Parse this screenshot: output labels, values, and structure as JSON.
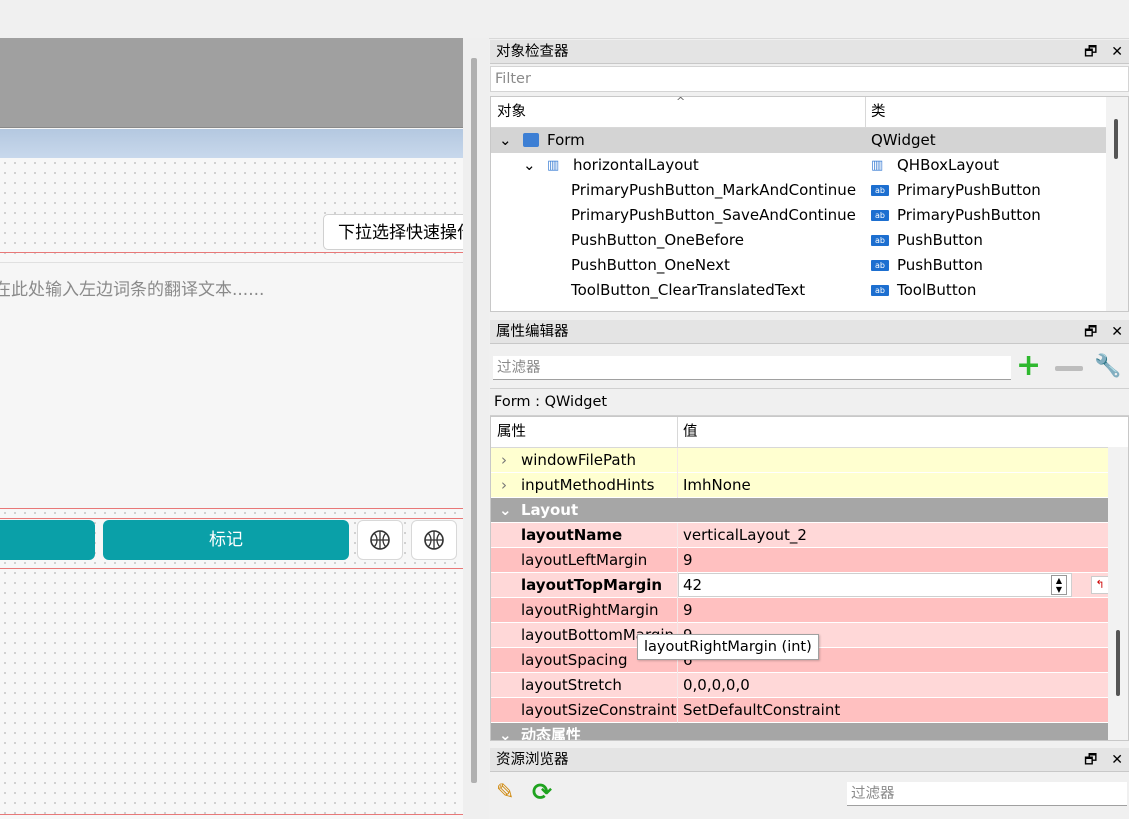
{
  "designer": {
    "dropdown_text": "下拉选择快速操作",
    "translation_placeholder": "在此处输入左边词条的翻译文本......",
    "mark_button": "标记"
  },
  "object_inspector": {
    "title": "对象检查器",
    "filter_placeholder": "Filter",
    "col_object": "对象",
    "col_class": "类",
    "rows": [
      {
        "name": "Form",
        "cls": "QWidget"
      },
      {
        "name": "horizontalLayout",
        "cls": "QHBoxLayout"
      },
      {
        "name": "PrimaryPushButton_MarkAndContinue",
        "cls": "PrimaryPushButton"
      },
      {
        "name": "PrimaryPushButton_SaveAndContinue",
        "cls": "PrimaryPushButton"
      },
      {
        "name": "PushButton_OneBefore",
        "cls": "PushButton"
      },
      {
        "name": "PushButton_OneNext",
        "cls": "PushButton"
      },
      {
        "name": "ToolButton_ClearTranslatedText",
        "cls": "ToolButton"
      }
    ]
  },
  "property_editor": {
    "title": "属性编辑器",
    "filter_placeholder": "过滤器",
    "context": "Form : QWidget",
    "col_prop": "属性",
    "col_value": "值",
    "rows": [
      {
        "name": "windowFilePath",
        "value": ""
      },
      {
        "name": "inputMethodHints",
        "value": "ImhNone"
      },
      {
        "name": "Layout",
        "value": ""
      },
      {
        "name": "layoutName",
        "value": "verticalLayout_2"
      },
      {
        "name": "layoutLeftMargin",
        "value": "9"
      },
      {
        "name": "layoutTopMargin",
        "value": "42"
      },
      {
        "name": "layoutRightMargin",
        "value": "9"
      },
      {
        "name": "layoutBottomMargin",
        "value": "9"
      },
      {
        "name": "layoutSpacing",
        "value": "6"
      },
      {
        "name": "layoutStretch",
        "value": "0,0,0,0,0"
      },
      {
        "name": "layoutSizeConstraint",
        "value": "SetDefaultConstraint"
      },
      {
        "name": "动态属性",
        "value": ""
      }
    ],
    "tooltip": "layoutRightMargin (int)"
  },
  "resource_browser": {
    "title": "资源浏览器",
    "filter_placeholder": "过滤器"
  },
  "colors": {
    "teal": "#0aa0a8",
    "pink": "#ffc0c0",
    "yellow": "#ffffd0",
    "group": "#a6a6a6"
  }
}
